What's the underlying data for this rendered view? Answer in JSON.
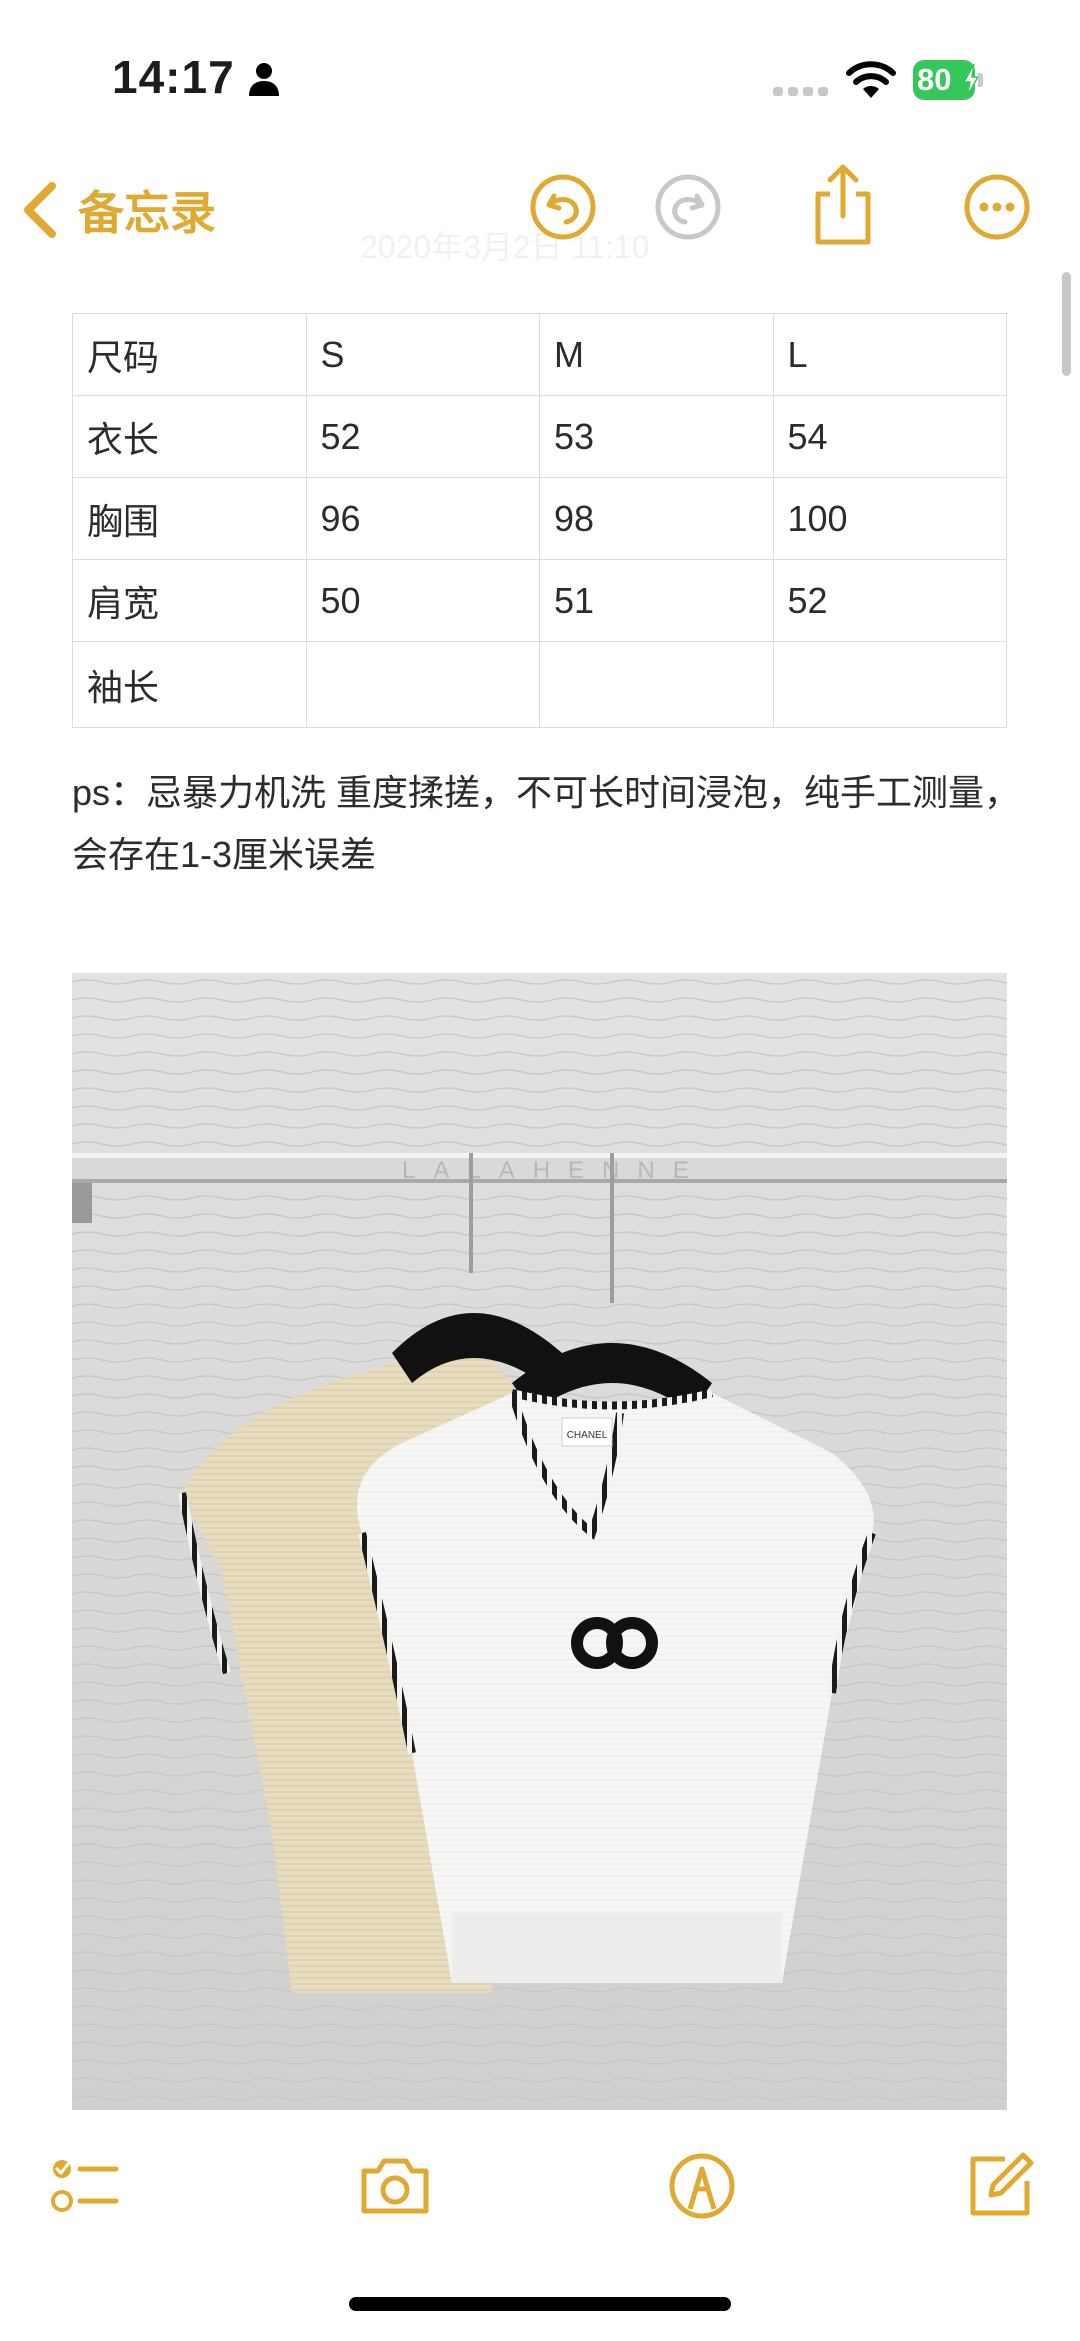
{
  "status_bar": {
    "time": "14:17",
    "battery_level": "80",
    "icons": [
      "person-icon",
      "signal-icon",
      "wifi-icon",
      "battery-charging-icon"
    ]
  },
  "nav": {
    "back_label": "备忘录",
    "icons": [
      "undo-icon",
      "redo-icon",
      "share-icon",
      "more-icon"
    ],
    "accent_color": "#dfa932"
  },
  "ghost_date": "2020年3月2日 11:10",
  "size_table": {
    "rows": [
      [
        "尺码",
        "S",
        "M",
        "L"
      ],
      [
        "衣长",
        "52",
        "53",
        "54"
      ],
      [
        "胸围",
        "96",
        "98",
        "100"
      ],
      [
        "肩宽",
        "50",
        "51",
        "52"
      ],
      [
        "袖长",
        "",
        "",
        ""
      ]
    ]
  },
  "note": "ps：忌暴力机洗 重度揉搓，不可长时间浸泡，纯手工测量，会存在1-3厘米误差",
  "photo": {
    "watermark": "LALAHENNE",
    "tag_text": "CHANEL"
  },
  "toolbar": {
    "icons": [
      "checklist-icon",
      "camera-icon",
      "markup-icon",
      "compose-icon"
    ]
  }
}
